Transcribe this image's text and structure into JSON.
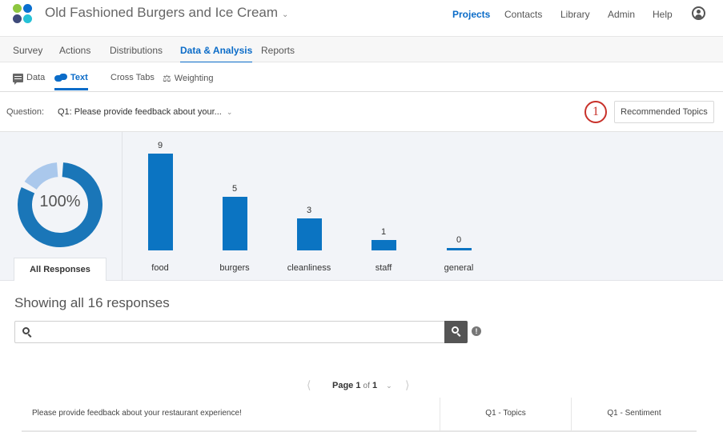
{
  "header": {
    "project_title": "Old Fashioned Burgers and Ice Cream",
    "nav": [
      {
        "label": "Projects",
        "active": true
      },
      {
        "label": "Contacts",
        "active": false
      },
      {
        "label": "Library",
        "active": false
      },
      {
        "label": "Admin",
        "active": false
      },
      {
        "label": "Help",
        "active": false
      }
    ],
    "user_icon": "user-circle-icon",
    "logo_colors": [
      "#8dc63f",
      "#0a6fcf",
      "#3e4a7a",
      "#25c1d6"
    ]
  },
  "main_tabs": [
    {
      "label": "Survey",
      "active": false
    },
    {
      "label": "Actions",
      "active": false
    },
    {
      "label": "Distributions",
      "active": false
    },
    {
      "label": "Data & Analysis",
      "active": true
    },
    {
      "label": "Reports",
      "active": false
    }
  ],
  "sub_tabs": [
    {
      "label": "Data",
      "icon": "data-icon",
      "active": false
    },
    {
      "label": "Text",
      "icon": "text-bubbles-icon",
      "active": true
    },
    {
      "label": "Cross Tabs",
      "icon": "grid-icon",
      "active": false
    },
    {
      "label": "Weighting",
      "icon": "scale-icon",
      "active": false
    }
  ],
  "question_bar": {
    "label": "Question:",
    "selected": "Q1: Please provide feedback about your...",
    "annotation": "1",
    "recommended_button": "Recommended Topics"
  },
  "summary": {
    "donut_label": "100%",
    "donut_primary_fraction": 0.83,
    "donut_secondary_fraction": 0.17,
    "tab_label": "All Responses"
  },
  "chart_data": {
    "type": "bar",
    "categories": [
      "food",
      "burgers",
      "cleanliness",
      "staff",
      "general"
    ],
    "values": [
      9,
      5,
      3,
      1,
      0
    ],
    "title": "",
    "xlabel": "",
    "ylabel": "",
    "color": "#0b74c2"
  },
  "responses": {
    "heading": "Showing all 16 responses",
    "search_value": "",
    "search_placeholder": "",
    "info_icon": "info-icon"
  },
  "pagination": {
    "page_word": "Page",
    "current": "1",
    "of_word": "of",
    "total": "1"
  },
  "table": {
    "columns": [
      "Please provide feedback about your restaurant experience!",
      "Q1 - Topics",
      "Q1 - Sentiment"
    ]
  }
}
